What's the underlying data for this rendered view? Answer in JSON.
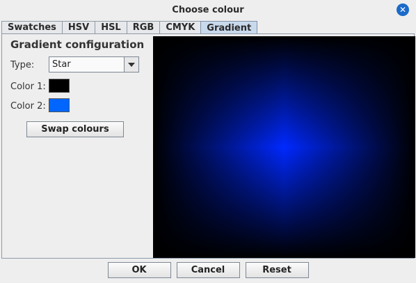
{
  "window": {
    "title": "Choose colour",
    "close_icon": "close-icon"
  },
  "tabs": [
    {
      "label": "Swatches",
      "active": false
    },
    {
      "label": "HSV",
      "active": false
    },
    {
      "label": "HSL",
      "active": false
    },
    {
      "label": "RGB",
      "active": false
    },
    {
      "label": "CMYK",
      "active": false
    },
    {
      "label": "Gradient",
      "active": true
    }
  ],
  "gradient": {
    "heading": "Gradient configuration",
    "type_label": "Type:",
    "type_value": "Star",
    "color1_label": "Color 1:",
    "color1": "#000000",
    "color2_label": "Color 2:",
    "color2": "#0066ff",
    "swap_label": "Swap colours"
  },
  "buttons": {
    "ok": "OK",
    "cancel": "Cancel",
    "reset": "Reset"
  }
}
